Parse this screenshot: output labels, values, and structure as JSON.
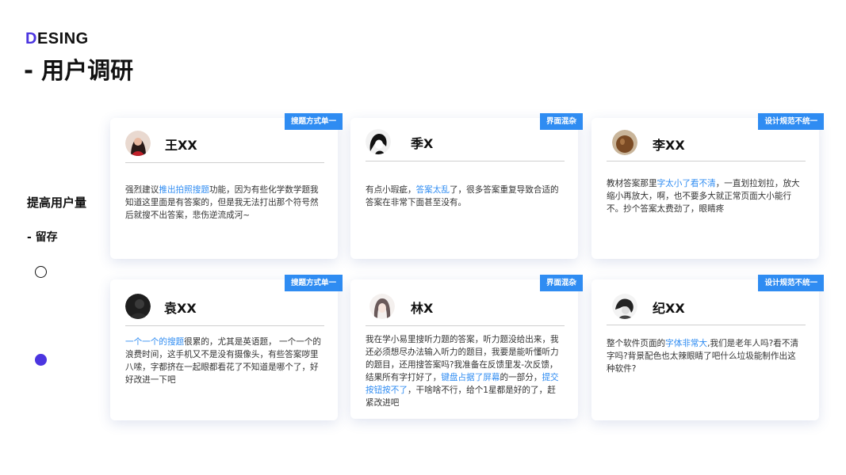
{
  "brand": {
    "first_letter": "D",
    "rest": "ESING"
  },
  "page_title": "- 用户调研",
  "side": {
    "title": "提高用户量",
    "subtitle": "- 留存"
  },
  "colors": {
    "accent": "#4b35e0",
    "tag": "#2f8cf2",
    "highlight": "#2f8cf2"
  },
  "cards": [
    {
      "tag": "搜题方式单一",
      "name": "王XX",
      "avatar": "avatar-woman-red",
      "segments": [
        {
          "text": "强烈建议",
          "hl": false
        },
        {
          "text": "推出拍照搜题",
          "hl": true
        },
        {
          "text": "功能，因为有些化学数学题我知道这里面是有答案的，但是我无法打出那个符号然后就搜不出答案，悲伤逆流成河~",
          "hl": false
        }
      ]
    },
    {
      "tag": "界面混杂",
      "name": "季X",
      "avatar": "avatar-black-white",
      "segments": [
        {
          "text": "有点小瑕疵，",
          "hl": false
        },
        {
          "text": "答案太乱",
          "hl": true
        },
        {
          "text": "了，很多答案重复导致合适的答案在非常下面甚至没有。",
          "hl": false
        }
      ]
    },
    {
      "tag": "设计规范不统一",
      "name": "李XX",
      "avatar": "avatar-brown",
      "segments": [
        {
          "text": "教材答案那里",
          "hl": false
        },
        {
          "text": "字太小了看不清",
          "hl": true
        },
        {
          "text": "，一直划拉划拉，放大缩小再放大，啊，也不要多大就正常页面大小能行不。抄个答案太费劲了，眼睛疼",
          "hl": false
        }
      ]
    },
    {
      "tag": "搜题方式单一",
      "name": "袁XX",
      "avatar": "avatar-dark",
      "segments": [
        {
          "text": "一个一个的搜题",
          "hl": true
        },
        {
          "text": "很累的，尤其是英语题， 一个一个的浪费时间，这手机又不是没有摄像头，有些答案哕里八嗦，字都挤在一起眼都看花了不知道是哪个了，好好改进一下吧",
          "hl": false
        }
      ]
    },
    {
      "tag": "界面混杂",
      "name": "林X",
      "avatar": "avatar-anime-girl",
      "segments": [
        {
          "text": "我在学小易里搜听力题的答案，听力题没给出来，我还必须想尽办法输入听力的题目，我要是能听懂听力的题目，还用搜答案吗?我准备在反馈里发-次反馈，结果所有字打好了，",
          "hl": false
        },
        {
          "text": "键盘占据了屏幕",
          "hl": true
        },
        {
          "text": "的一部分，",
          "hl": false
        },
        {
          "text": "提交按钮按不了",
          "hl": true
        },
        {
          "text": "，干啥啥不行，给个1星都是好的了，赶紧改进吧",
          "hl": false
        }
      ]
    },
    {
      "tag": "设计规范不统一",
      "name": "纪XX",
      "avatar": "avatar-sketch",
      "segments": [
        {
          "text": "整个软件页面的",
          "hl": false
        },
        {
          "text": "字体非常大",
          "hl": true
        },
        {
          "text": ",我们是老年人吗?看不清字吗?背景配色也太辣眼睛了吧什么垃圾能制作出这种软件?",
          "hl": false
        }
      ]
    }
  ]
}
